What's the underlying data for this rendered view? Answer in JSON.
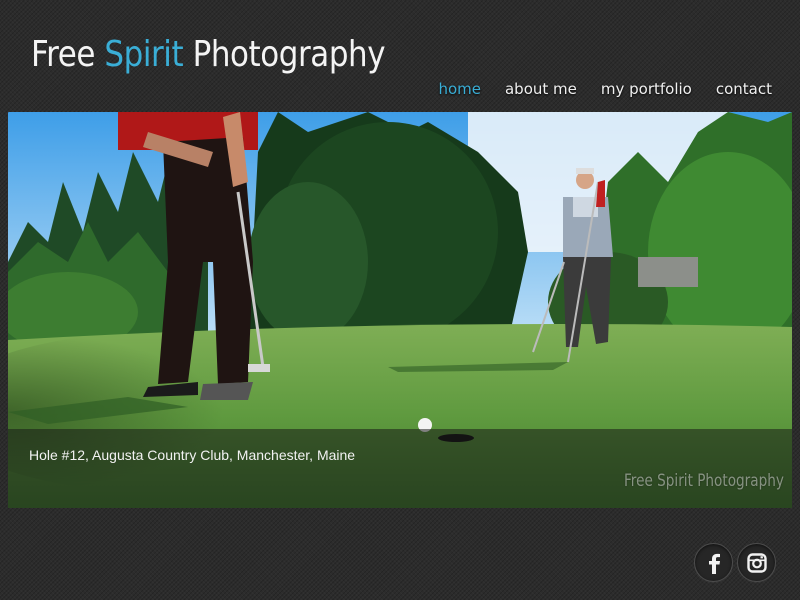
{
  "site": {
    "logo_part1": "Free ",
    "logo_part2": "Spirit",
    "logo_part3": " Photography",
    "accent_color": "#3aaed6"
  },
  "nav": {
    "items": [
      {
        "label": "home",
        "active": true
      },
      {
        "label": "about me",
        "active": false
      },
      {
        "label": "my portfolio",
        "active": false
      },
      {
        "label": "contact",
        "active": false
      }
    ]
  },
  "hero": {
    "caption": "Hole #12, Augusta Country Club, Manchester, Maine",
    "watermark": "Free Spirit Photography"
  },
  "social": {
    "icons": [
      "facebook-icon",
      "instagram-icon"
    ]
  }
}
